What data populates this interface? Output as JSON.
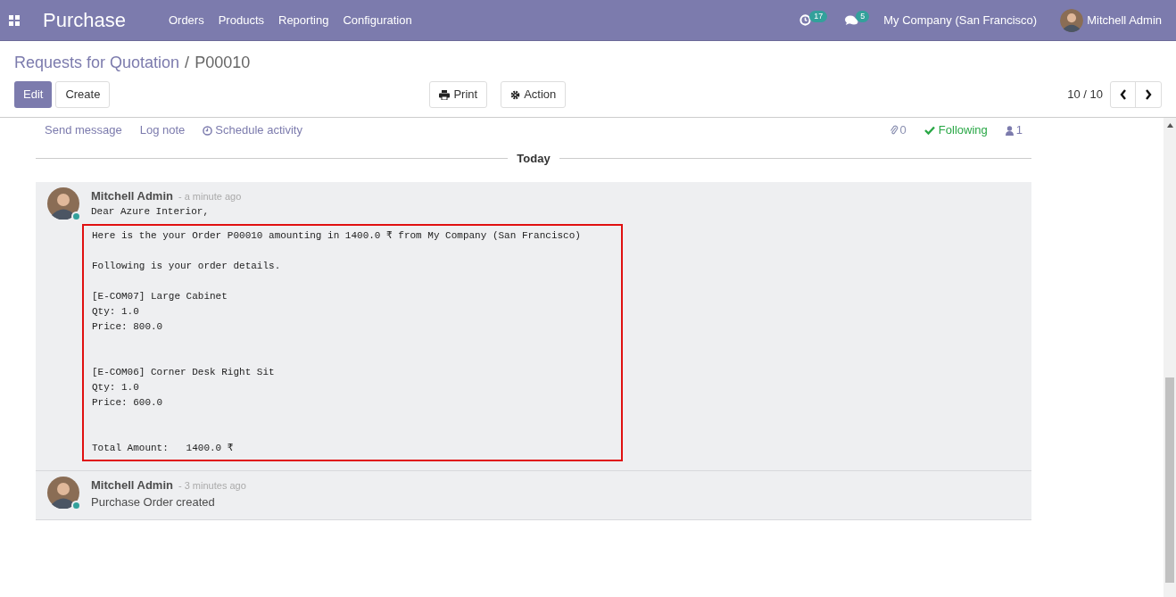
{
  "navbar": {
    "app_name": "Purchase",
    "menu": [
      "Orders",
      "Products",
      "Reporting",
      "Configuration"
    ],
    "activity_count": "17",
    "message_count": "5",
    "company": "My Company (San Francisco)",
    "user": "Mitchell Admin"
  },
  "breadcrumb": {
    "parent": "Requests for Quotation",
    "separator": "/",
    "current": "P00010"
  },
  "buttons": {
    "edit": "Edit",
    "create": "Create",
    "print": "Print",
    "action": "Action"
  },
  "pager": "10 / 10",
  "chatter": {
    "send_message": "Send message",
    "log_note": "Log note",
    "schedule_activity": "Schedule activity",
    "attachments": "0",
    "following": "Following",
    "followers": "1"
  },
  "date_separator": "Today",
  "messages": [
    {
      "author": "Mitchell Admin",
      "date": "- a minute ago",
      "online": true,
      "kind": "email",
      "greeting": "Dear Azure Interior,",
      "highlighted": true,
      "body": "Here is the your Order P00010 amounting in 1400.0 ₹ from My Company (San Francisco)\n\nFollowing is your order details.\n\n[E-COM07] Large Cabinet\nQty: 1.0\nPrice: 800.0\n\n\n[E-COM06] Corner Desk Right Sit\nQty: 1.0\nPrice: 600.0\n\n\nTotal Amount:   1400.0 ₹"
    },
    {
      "author": "Mitchell Admin",
      "date": "- 3 minutes ago",
      "online": true,
      "kind": "note",
      "body": "Purchase Order created"
    }
  ]
}
